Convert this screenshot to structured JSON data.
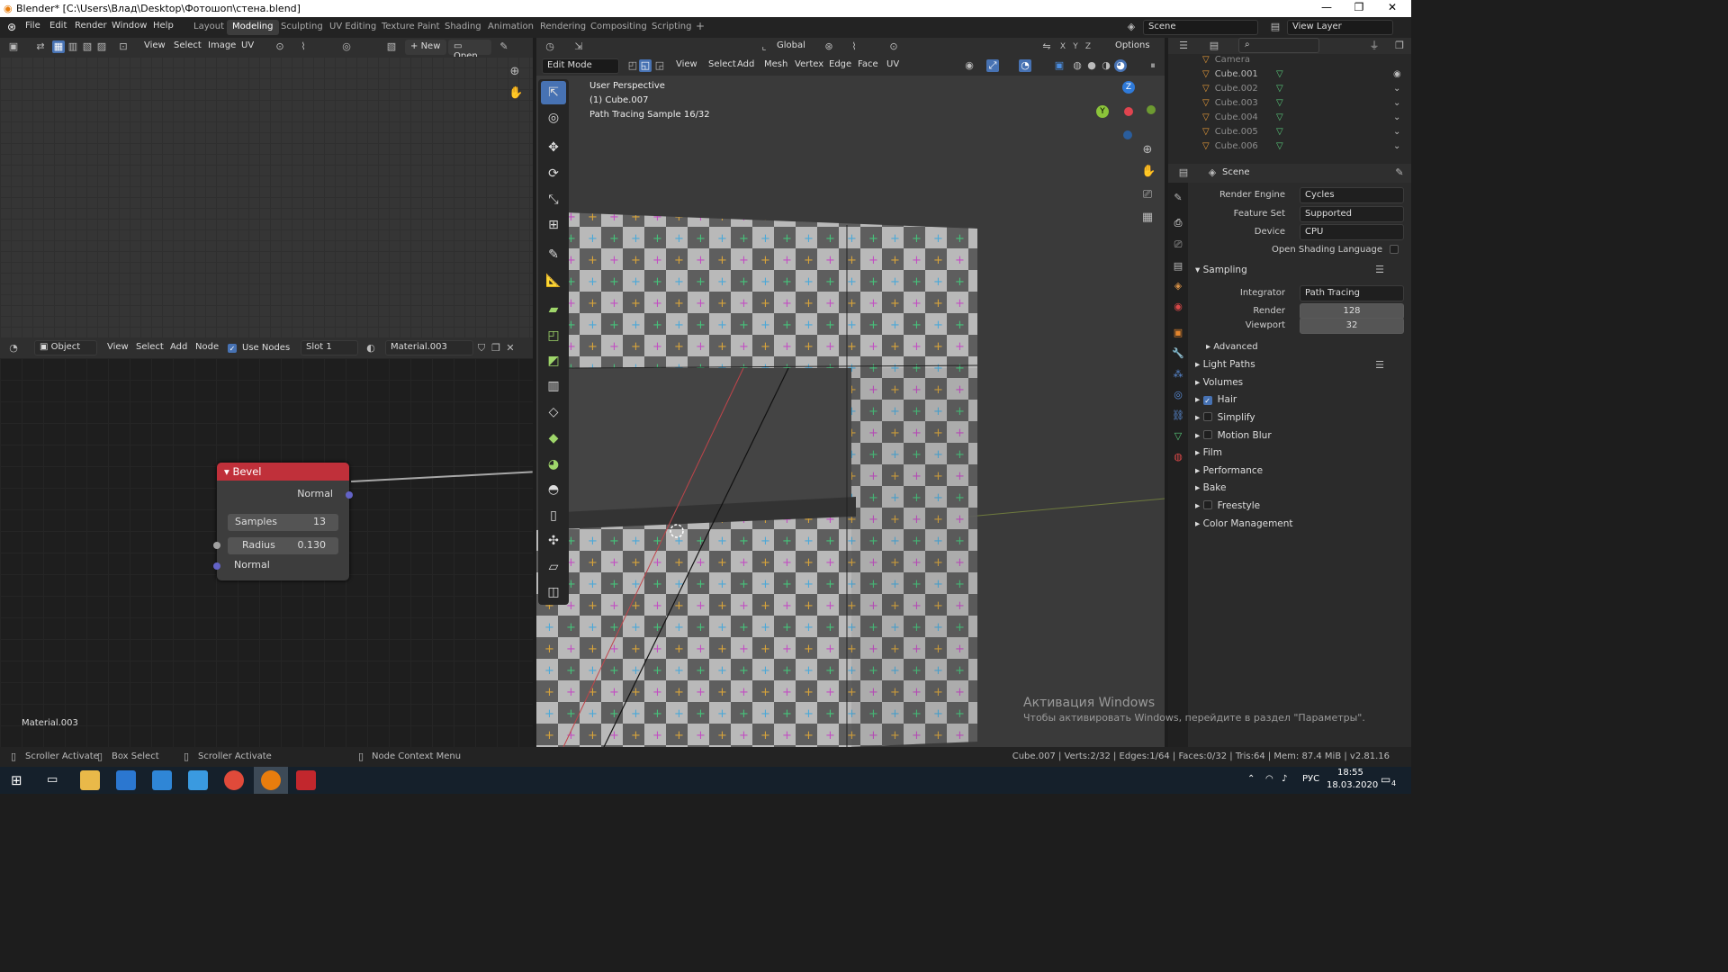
{
  "window": {
    "title": "Blender* [C:\\Users\\Влад\\Desktop\\Фотошоп\\стена.blend]",
    "min": "—",
    "max": "❐",
    "close": "✕"
  },
  "menu": [
    "File",
    "Edit",
    "Render",
    "Window",
    "Help"
  ],
  "workspaces": [
    "Layout",
    "Modeling",
    "Sculpting",
    "UV Editing",
    "Texture Paint",
    "Shading",
    "Animation",
    "Rendering",
    "Compositing",
    "Scripting"
  ],
  "active_workspace": "Modeling",
  "add_tab": "+",
  "scene": {
    "label": "Scene",
    "view_layer": "View Layer"
  },
  "image_editor": {
    "menus": [
      "View",
      "Select",
      "Image",
      "UV"
    ],
    "new_label": "New",
    "open_label": "Open"
  },
  "node_editor": {
    "mode": "Object",
    "menus": [
      "View",
      "Select",
      "Add",
      "Node"
    ],
    "use_nodes": "Use Nodes",
    "slot": "Slot 1",
    "material": "Material.003",
    "material_label": "Material.003"
  },
  "node": {
    "title": "Bevel",
    "output": "Normal",
    "samples_label": "Samples",
    "samples": "13",
    "radius_label": "Radius",
    "radius": "0.130",
    "input": "Normal"
  },
  "viewport": {
    "mode": "Edit Mode",
    "menus": [
      "View",
      "Select",
      "Add",
      "Mesh",
      "Vertex",
      "Edge",
      "Face",
      "UV"
    ],
    "orientation": "Global",
    "options": "Options",
    "overlay1": "User Perspective",
    "overlay2": "(1) Cube.007",
    "overlay3": "Path Tracing Sample 16/32",
    "gizmo": {
      "z": "Z",
      "y": "Y"
    }
  },
  "outliner": {
    "items": [
      "Camera",
      "Cube.001",
      "Cube.002",
      "Cube.003",
      "Cube.004",
      "Cube.005",
      "Cube.006"
    ]
  },
  "properties": {
    "context": "Scene",
    "render_engine_label": "Render Engine",
    "render_engine": "Cycles",
    "feature_set_label": "Feature Set",
    "feature_set": "Supported",
    "device_label": "Device",
    "device": "CPU",
    "osl_label": "Open Shading Language",
    "sampling": "Sampling",
    "integrator_label": "Integrator",
    "integrator": "Path Tracing",
    "render_label": "Render",
    "render": "128",
    "viewport_label": "Viewport",
    "viewport": "32",
    "advanced": "Advanced",
    "sections": [
      "Light Paths",
      "Volumes",
      "Hair",
      "Simplify",
      "Motion Blur",
      "Film",
      "Performance",
      "Bake",
      "Freestyle",
      "Color Management"
    ]
  },
  "status": {
    "left1": "Scroller Activate",
    "left2": "Box Select",
    "left3": "Scroller Activate",
    "mid": "Node Context Menu",
    "right": "Cube.007 | Verts:2/32 | Edges:1/64 | Faces:0/32 | Tris:64 | Mem: 87.4 MiB | v2.81.16"
  },
  "watermark": {
    "line1": "Активация Windows",
    "line2": "Чтобы активировать Windows, перейдите в раздел \"Параметры\"."
  },
  "taskbar": {
    "lang": "РУС",
    "time": "18:55",
    "date": "18.03.2020",
    "notif": "4"
  },
  "colors": {
    "accent": "#4772b3",
    "node_header": "#c0303a"
  }
}
